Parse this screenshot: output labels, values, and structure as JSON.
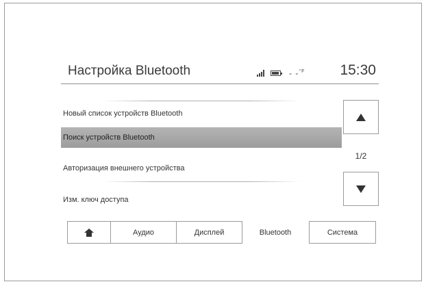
{
  "header": {
    "title": "Настройка Bluetooth",
    "temperature": "- -",
    "temperature_unit": "°F",
    "clock": "15:30"
  },
  "icons": {
    "signal": "signal-strength-icon",
    "battery": "battery-icon",
    "home": "home-icon",
    "scroll_up": "arrow-up-icon",
    "scroll_down": "arrow-down-icon"
  },
  "menu": {
    "items": [
      {
        "label": "Новый список устройств Bluetooth",
        "selected": false
      },
      {
        "label": "Поиск устройств Bluetooth",
        "selected": true
      },
      {
        "label": "Авторизация внешнего устройства",
        "selected": false
      },
      {
        "label": "Изм. ключ доступа",
        "selected": false
      }
    ],
    "page_indicator": "1/2"
  },
  "tabs": [
    {
      "label": "",
      "icon": "home-icon"
    },
    {
      "label": "Аудио"
    },
    {
      "label": "Дисплей"
    },
    {
      "label": "Bluetooth",
      "active": true
    },
    {
      "label": "Система"
    }
  ],
  "colors": {
    "selected_row": "#a8a8a8",
    "border": "#9a9a9a",
    "text": "#333333"
  }
}
